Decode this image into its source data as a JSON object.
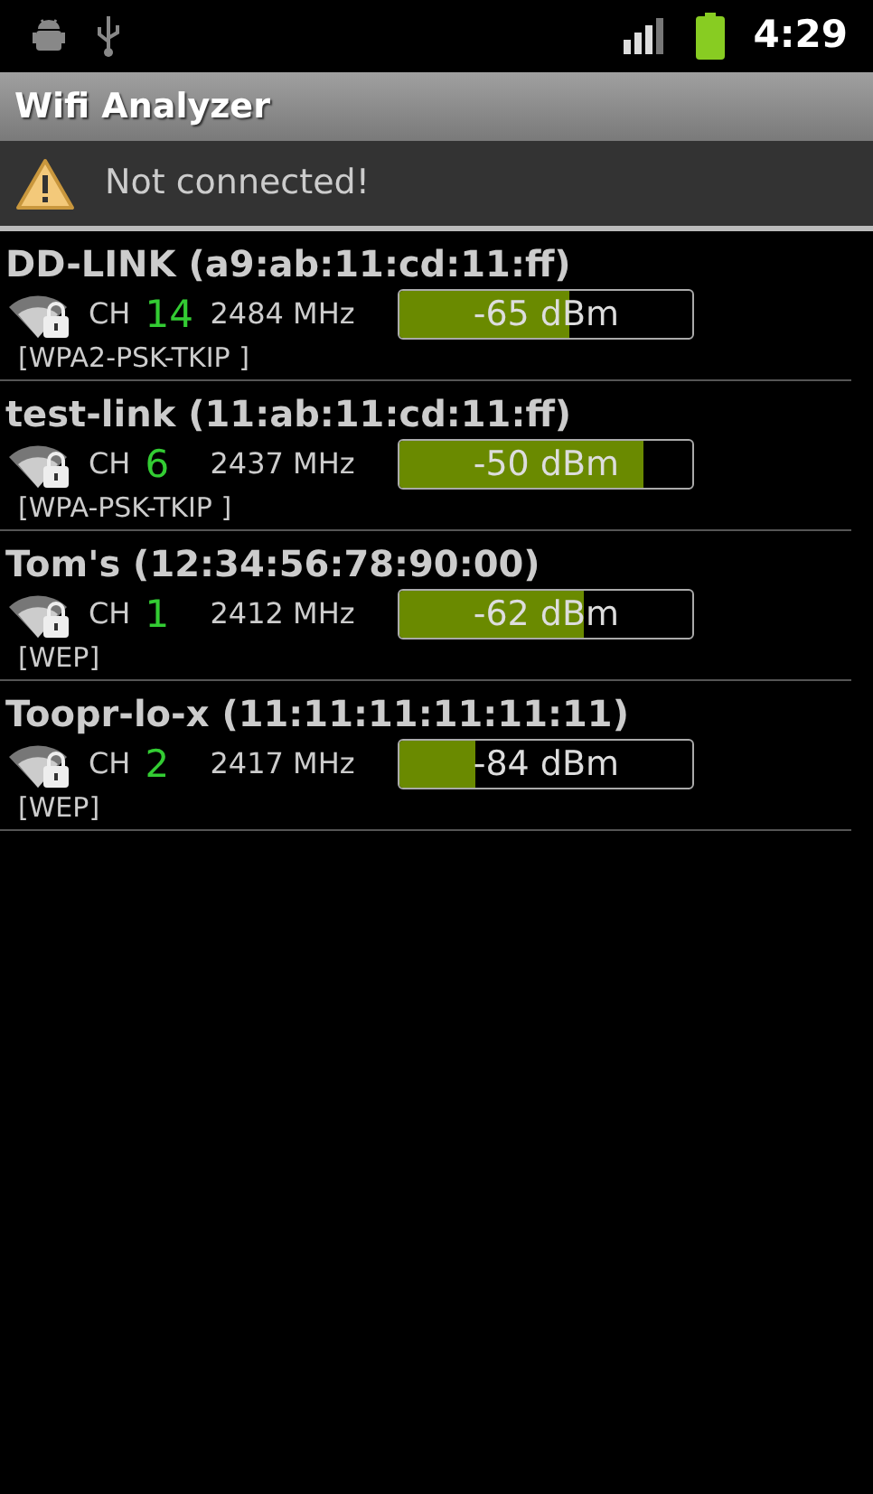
{
  "status_bar": {
    "time": "4:29"
  },
  "window": {
    "title": "Wifi Analyzer"
  },
  "notice": {
    "text": "Not connected!"
  },
  "networks": [
    {
      "name": "DD-LINK (a9:ab:11:cd:11:ff)",
      "channel_label": "CH",
      "channel": "14",
      "frequency": "2484 MHz",
      "level": 0.58,
      "reading": "-65 dBm",
      "security": "[WPA2-PSK-TKIP ]"
    },
    {
      "name": "test-link (11:ab:11:cd:11:ff)",
      "channel_label": "CH",
      "channel": "6",
      "frequency": "2437 MHz",
      "level": 0.83,
      "reading": "-50 dBm",
      "security": "[WPA-PSK-TKIP ]"
    },
    {
      "name": "Tom's (12:34:56:78:90:00)",
      "channel_label": "CH",
      "channel": "1",
      "frequency": "2412 MHz",
      "level": 0.63,
      "reading": "-62 dBm",
      "security": "[WEP]"
    },
    {
      "name": "Toopr-lo-x (11:11:11:11:11:11)",
      "channel_label": "CH",
      "channel": "2",
      "frequency": "2417 MHz",
      "level": 0.26,
      "reading": "-84 dBm",
      "security": "[WEP]"
    }
  ]
}
